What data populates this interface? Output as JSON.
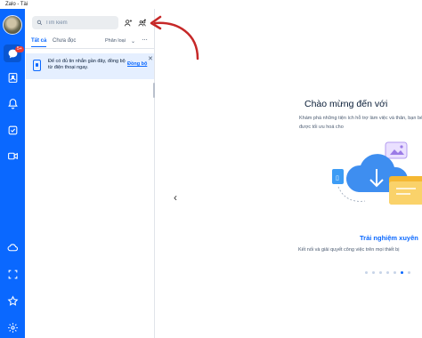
{
  "window": {
    "title": "Zalo - Tài"
  },
  "rail": {
    "badge": "5+",
    "items": [
      "chat-icon",
      "contacts-icon",
      "bell-icon",
      "todo-icon",
      "video-icon",
      "cloud-icon",
      "screenshot-icon",
      "star-icon",
      "settings-icon"
    ],
    "accent": "#0a68ff"
  },
  "panel": {
    "search_placeholder": "Tìm kiếm",
    "tabs": [
      {
        "label": "Tất cả"
      },
      {
        "label": "Chưa đọc"
      }
    ],
    "filter_label": "Phân loại",
    "filter_chevron": "⌄",
    "more_label": "···",
    "banner": {
      "text": "Để có đủ tin nhắn gần đây, đồng bộ từ điện thoại ngay.",
      "action": "Đồng bộ",
      "close": "✕"
    }
  },
  "main": {
    "welcome": "Chào mừng đến với",
    "description": "Khám phá những tiện ích hỗ trợ làm việc và thân, bạn bè được tối ưu hoá cho",
    "prev": "‹",
    "slide_title": "Trải nghiệm xuyên",
    "slide_description": "Kết nối và giải quyết công việc trên mọi thiết bị",
    "dots": [
      false,
      false,
      false,
      false,
      false,
      true,
      false
    ]
  }
}
